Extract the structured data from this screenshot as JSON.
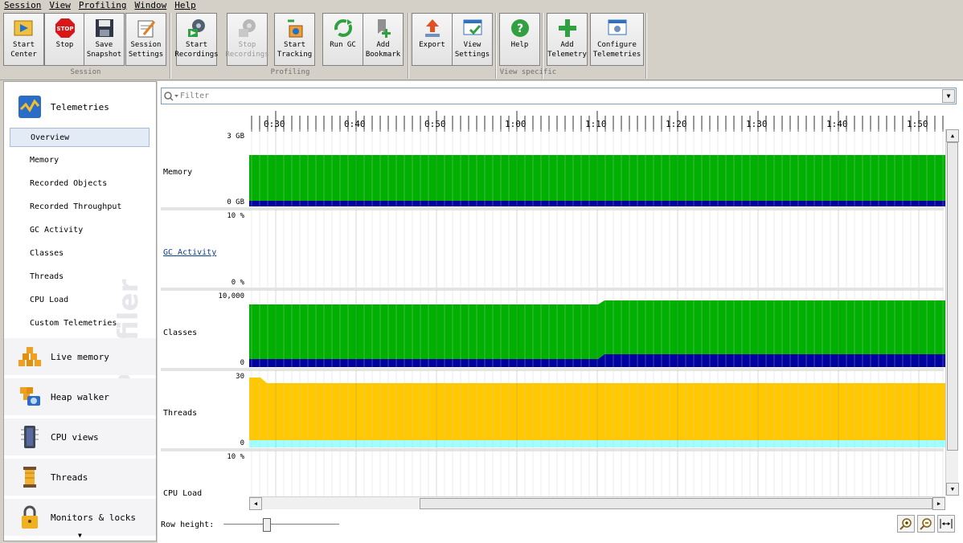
{
  "menu": [
    "Session",
    "View",
    "Profiling",
    "Window",
    "Help"
  ],
  "toolbar": {
    "groups": [
      "Session",
      "Profiling",
      "View specific"
    ],
    "buttons": {
      "start_center": "Start\nCenter",
      "stop": "Stop",
      "save_snapshot": "Save\nSnapshot",
      "session_settings": "Session\nSettings",
      "start_recordings": "Start\nRecordings",
      "stop_recordings": "Stop\nRecordings",
      "start_tracking": "Start\nTracking",
      "run_gc": "Run GC",
      "add_bookmark": "Add\nBookmark",
      "export": "Export",
      "view_settings": "View\nSettings",
      "help": "Help",
      "add_telemetry": "Add\nTelemetry",
      "configure_telemetries": "Configure\nTelemetries"
    },
    "stop_icon_text": "STOP"
  },
  "sidebar": {
    "sections": {
      "telemetries": "Telemetries",
      "live_memory": "Live memory",
      "heap_walker": "Heap walker",
      "cpu_views": "CPU views",
      "threads": "Threads",
      "monitors_locks": "Monitors & locks"
    },
    "telemetry_items": [
      "Overview",
      "Memory",
      "Recorded Objects",
      "Recorded Throughput",
      "GC Activity",
      "Classes",
      "Threads",
      "CPU Load",
      "Custom Telemetries"
    ],
    "selected": "Overview",
    "watermark": "JProfiler"
  },
  "filter": {
    "placeholder": "Filter"
  },
  "timeline": {
    "ticks": [
      "0:30",
      "0:40",
      "0:50",
      "1:00",
      "1:10",
      "1:20",
      "1:30",
      "1:40",
      "1:50"
    ]
  },
  "rows": {
    "memory": {
      "label": "Memory",
      "top": "3 GB",
      "bottom": "0 GB"
    },
    "gc": {
      "label": "GC Activity",
      "top": "10 %",
      "bottom": "0 %"
    },
    "classes": {
      "label": "Classes",
      "top": "10,000",
      "bottom": "0"
    },
    "threads": {
      "label": "Threads",
      "top": "30",
      "bottom": "0"
    },
    "cpu": {
      "label": "CPU Load",
      "top": "10 %"
    }
  },
  "bottom": {
    "row_height_label": "Row height:"
  },
  "colors": {
    "green": "#00b000",
    "navy": "#0000a0",
    "yellow": "#ffc800",
    "cyan": "#a0ffff"
  }
}
